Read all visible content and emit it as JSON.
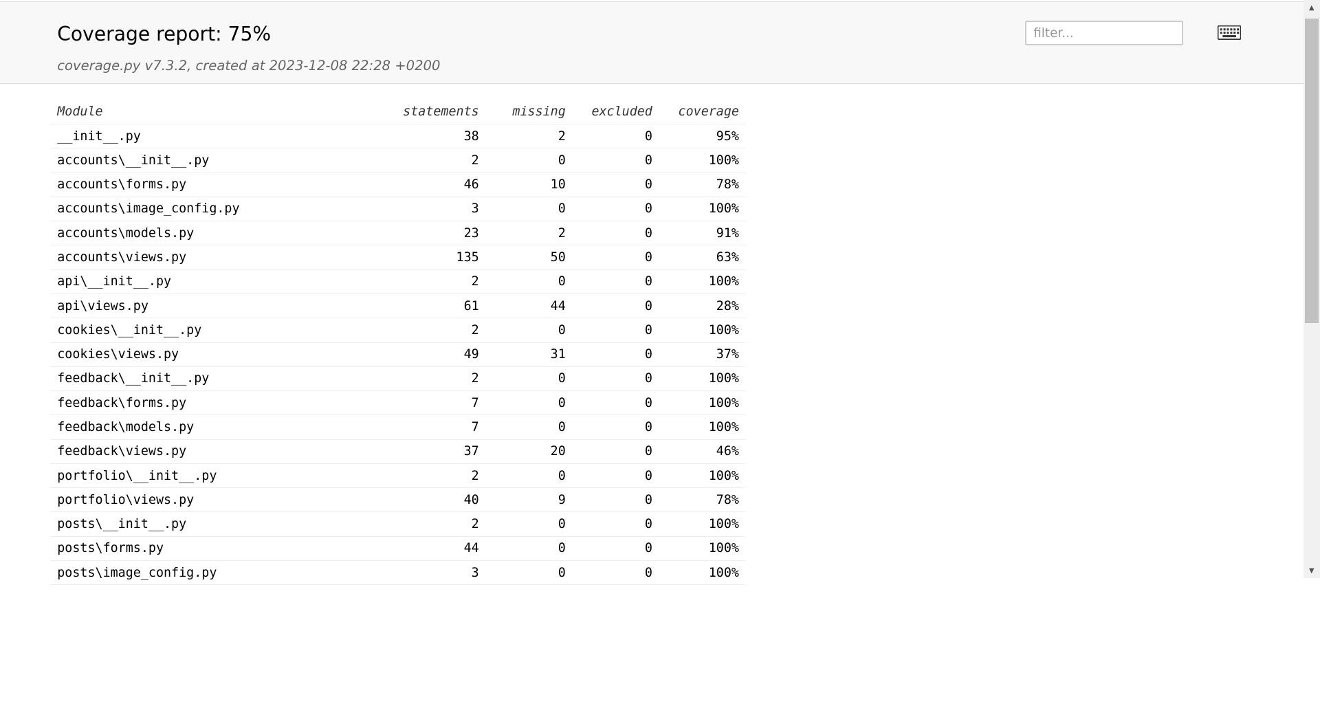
{
  "header": {
    "title": "Coverage report: 75%",
    "subtitle": "coverage.py v7.3.2, created at 2023-12-08 22:28 +0200",
    "filter_placeholder": "filter...",
    "keyboard_icon": "keyboard-icon"
  },
  "table": {
    "columns": [
      "Module",
      "statements",
      "missing",
      "excluded",
      "coverage"
    ],
    "rows": [
      {
        "module": "__init__.py",
        "statements": "38",
        "missing": "2",
        "excluded": "0",
        "coverage": "95%"
      },
      {
        "module": "accounts\\__init__.py",
        "statements": "2",
        "missing": "0",
        "excluded": "0",
        "coverage": "100%"
      },
      {
        "module": "accounts\\forms.py",
        "statements": "46",
        "missing": "10",
        "excluded": "0",
        "coverage": "78%"
      },
      {
        "module": "accounts\\image_config.py",
        "statements": "3",
        "missing": "0",
        "excluded": "0",
        "coverage": "100%"
      },
      {
        "module": "accounts\\models.py",
        "statements": "23",
        "missing": "2",
        "excluded": "0",
        "coverage": "91%"
      },
      {
        "module": "accounts\\views.py",
        "statements": "135",
        "missing": "50",
        "excluded": "0",
        "coverage": "63%"
      },
      {
        "module": "api\\__init__.py",
        "statements": "2",
        "missing": "0",
        "excluded": "0",
        "coverage": "100%"
      },
      {
        "module": "api\\views.py",
        "statements": "61",
        "missing": "44",
        "excluded": "0",
        "coverage": "28%"
      },
      {
        "module": "cookies\\__init__.py",
        "statements": "2",
        "missing": "0",
        "excluded": "0",
        "coverage": "100%"
      },
      {
        "module": "cookies\\views.py",
        "statements": "49",
        "missing": "31",
        "excluded": "0",
        "coverage": "37%"
      },
      {
        "module": "feedback\\__init__.py",
        "statements": "2",
        "missing": "0",
        "excluded": "0",
        "coverage": "100%"
      },
      {
        "module": "feedback\\forms.py",
        "statements": "7",
        "missing": "0",
        "excluded": "0",
        "coverage": "100%"
      },
      {
        "module": "feedback\\models.py",
        "statements": "7",
        "missing": "0",
        "excluded": "0",
        "coverage": "100%"
      },
      {
        "module": "feedback\\views.py",
        "statements": "37",
        "missing": "20",
        "excluded": "0",
        "coverage": "46%"
      },
      {
        "module": "portfolio\\__init__.py",
        "statements": "2",
        "missing": "0",
        "excluded": "0",
        "coverage": "100%"
      },
      {
        "module": "portfolio\\views.py",
        "statements": "40",
        "missing": "9",
        "excluded": "0",
        "coverage": "78%"
      },
      {
        "module": "posts\\__init__.py",
        "statements": "2",
        "missing": "0",
        "excluded": "0",
        "coverage": "100%"
      },
      {
        "module": "posts\\forms.py",
        "statements": "44",
        "missing": "0",
        "excluded": "0",
        "coverage": "100%"
      },
      {
        "module": "posts\\image_config.py",
        "statements": "3",
        "missing": "0",
        "excluded": "0",
        "coverage": "100%"
      }
    ]
  },
  "scrollbar": {
    "up_icon": "scroll-up-arrow-icon",
    "down_icon": "scroll-down-arrow-icon"
  }
}
